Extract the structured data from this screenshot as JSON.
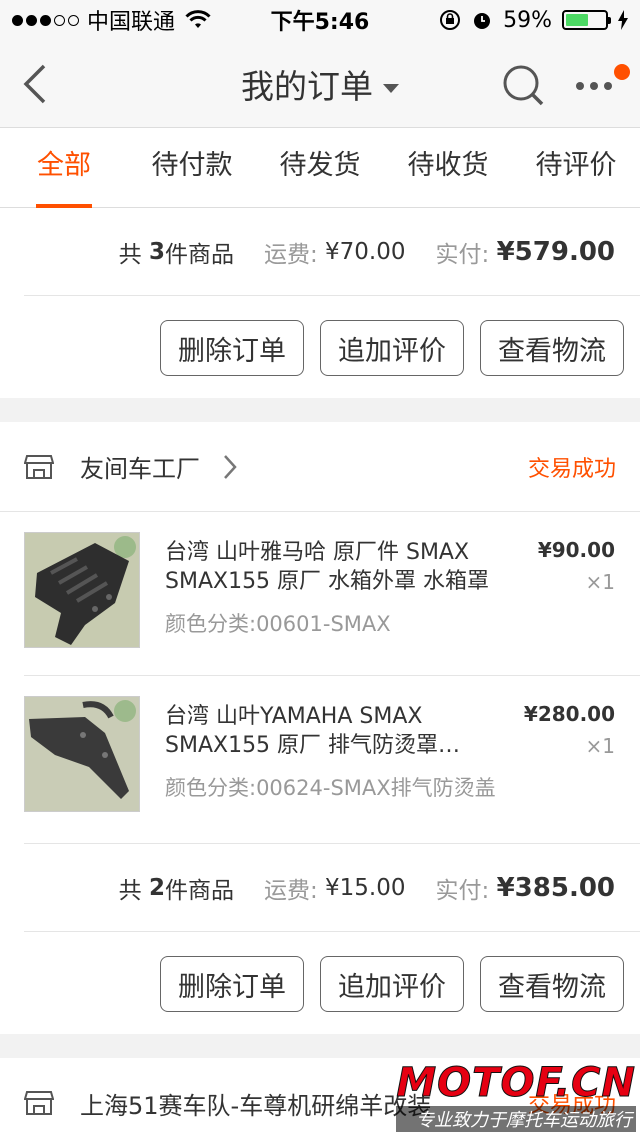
{
  "status_bar": {
    "carrier": "中国联通",
    "time": "下午5:46",
    "battery": "59%",
    "battery_level": 0.59,
    "signal_bars_on": 3,
    "signal_bars_total": 5
  },
  "nav": {
    "title": "我的订单",
    "icons": {
      "back": "chevron-left-icon",
      "search": "search-icon",
      "more": "more-icon"
    }
  },
  "tabs": [
    {
      "label": "全部",
      "active": true
    },
    {
      "label": "待付款",
      "active": false
    },
    {
      "label": "待发货",
      "active": false
    },
    {
      "label": "待收货",
      "active": false
    },
    {
      "label": "待评价",
      "active": false
    }
  ],
  "orders": [
    {
      "summary": {
        "count_prefix": "共",
        "count": "3",
        "count_suffix": "件商品",
        "shipping_label": "运费:",
        "shipping": "¥70.00",
        "paid_label": "实付:",
        "paid": "¥579.00"
      },
      "actions": [
        "删除订单",
        "追加评价",
        "查看物流"
      ]
    },
    {
      "shop": "友间车工厂",
      "status": "交易成功",
      "items": [
        {
          "title": "台湾 山叶雅马哈 原厂件 SMAX SMAX155 原厂 水箱外罩 水箱罩",
          "spec": "颜色分类:00601-SMAX",
          "price": "¥90.00",
          "qty": "×1"
        },
        {
          "title": "台湾 山叶YAMAHA SMAX SMAX155 原厂 排气防烫罩…",
          "spec": "颜色分类:00624-SMAX排气防烫盖",
          "price": "¥280.00",
          "qty": "×1"
        }
      ],
      "summary": {
        "count_prefix": "共",
        "count": "2",
        "count_suffix": "件商品",
        "shipping_label": "运费:",
        "shipping": "¥15.00",
        "paid_label": "实付:",
        "paid": "¥385.00"
      },
      "actions": [
        "删除订单",
        "追加评价",
        "查看物流"
      ]
    },
    {
      "shop": "上海51赛车队-车尊机研绵羊改装",
      "status": "交易成功"
    }
  ],
  "watermark": {
    "logo": "MOTOF.CN",
    "tagline": "专业致力于摩托车运动旅行"
  },
  "colors": {
    "accent": "#ff5000",
    "battery": "#4cd964"
  }
}
